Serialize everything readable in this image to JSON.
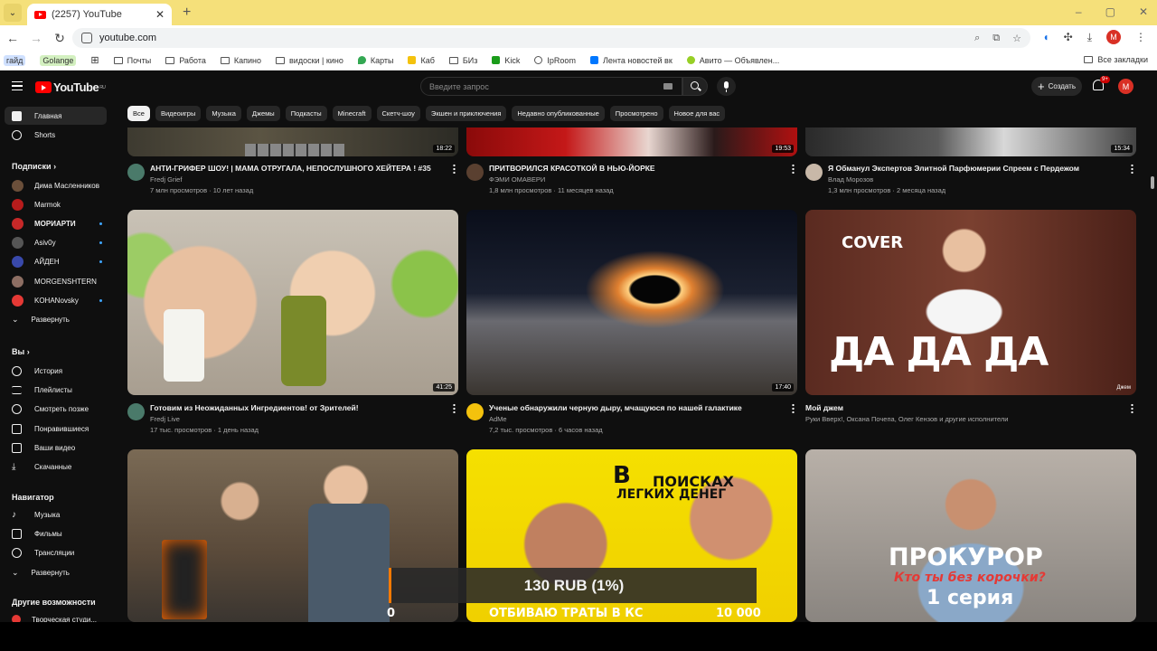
{
  "browser": {
    "tab_title": "(2257) YouTube",
    "url": "youtube.com",
    "bookmarks": [
      "гайд",
      "Golange",
      "Почты",
      "Работа",
      "Капино",
      "видоски | кино",
      "Карты",
      "Каб",
      "БИз",
      "Kick",
      "IpRoom",
      "Лента новостей вк",
      "Авито — Объявлен..."
    ],
    "all_bookmarks": "Все закладки"
  },
  "youtube": {
    "region": "RU",
    "search_placeholder": "Введите запрос",
    "create_label": "Создать",
    "notif_count": "9+",
    "avatar_letter": "M",
    "logo_text": "YouTube"
  },
  "sidebar": {
    "home": "Главная",
    "shorts": "Shorts",
    "subs_header": "Подписки",
    "subscriptions": [
      "Дима Масленников",
      "Marmok",
      "МОРИАРТИ",
      "Asiv0y",
      "АЙДЕН",
      "MORGENSHTERN",
      "KOHANovsky"
    ],
    "expand": "Развернуть",
    "you_header": "Вы",
    "you_items": [
      "История",
      "Плейлисты",
      "Смотреть позже",
      "Понравившиеся",
      "Ваши видео",
      "Скачанные"
    ],
    "nav_header": "Навигатор",
    "nav_items": [
      "Музыка",
      "Фильмы",
      "Трансляции",
      "Развернуть"
    ],
    "more_header": "Другие возможности",
    "more_items": [
      "Творческая студи..."
    ]
  },
  "chips": [
    "Все",
    "Видеоигры",
    "Музыка",
    "Джемы",
    "Подкасты",
    "Minecraft",
    "Скетч-шоу",
    "Экшен и приключения",
    "Недавно опубликованные",
    "Просмотрено",
    "Новое для вас"
  ],
  "videos": [
    {
      "title": "АНТИ-ГРИФЕР ШОУ! | МАМА ОТРУГАЛА, НЕПОСЛУШНОГО ХЕЙТЕРА ! #35",
      "channel": "Fredj Grief",
      "meta": "7 млн просмотров · 10 лет назад",
      "duration": "18:22"
    },
    {
      "title": "ПРИТВОРИЛСЯ КРАСОТКОЙ В НЬЮ-ЙОРКЕ",
      "channel": "ФЭМИ ОМАВЕРИ",
      "meta": "1,8 млн просмотров · 11 месяцев назад",
      "duration": "19:53"
    },
    {
      "title": "Я Обманул Экспертов Элитной Парфюмерии Спреем с Пердежом",
      "channel": "Влад Морозов",
      "meta": "1,3 млн просмотров · 2 месяца назад",
      "duration": "15:34"
    },
    {
      "title": "Готовим из Неожиданных Ингредиентов! от Зрителей!",
      "channel": "Fredj Live",
      "meta": "17 тыс. просмотров · 1 день назад",
      "duration": "41:25"
    },
    {
      "title": "Ученые обнаружили черную дыру, мчащуюся по нашей галактике",
      "channel": "AdMe",
      "meta": "7,2 тыс. просмотров · 6 часов назад",
      "duration": "17:40"
    },
    {
      "title": "Мой джем",
      "channel": "Руки Вверх!, Оксана Почепа, Олег Кензов и другие исполнители",
      "meta": "",
      "duration": ""
    }
  ],
  "thumb_text": {
    "cover": "COVER",
    "dadada": "ДА ДА ДА",
    "jem_tag": "Джем",
    "poiski_v": "В",
    "poiski": "ПОИСКАХ",
    "legkih": "ЛЕГКИХ ДЕНЕГ",
    "otbivau": "ОТБИВАЮ ТРАТЫ В КС",
    "zero": "0",
    "tenk": "10 000",
    "prokuror": "ПРОКУРОР",
    "kto": "Кто ты без корочки?",
    "seria": "1 серия"
  },
  "overlay_text": "130 RUB (1%)"
}
